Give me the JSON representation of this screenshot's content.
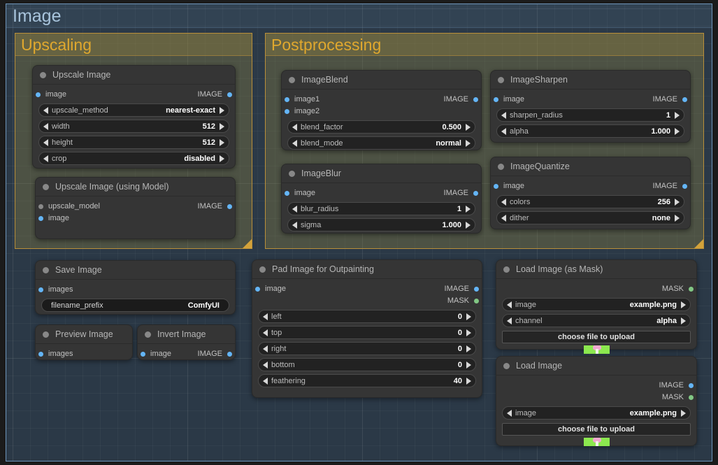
{
  "outer_group": {
    "title": "Image",
    "color": "#6e95bb"
  },
  "groups": [
    {
      "title": "Upscaling",
      "color": "#b98f3a"
    },
    {
      "title": "Postprocessing",
      "color": "#b98f3a"
    }
  ],
  "nodes": {
    "upscale_image": {
      "title": "Upscale Image",
      "inputs": [
        {
          "label": "image",
          "type": "IMAGE"
        }
      ],
      "outputs": [
        {
          "label": "IMAGE",
          "type": "IMAGE"
        }
      ],
      "widgets": [
        {
          "name": "upscale_method",
          "value": "nearest-exact"
        },
        {
          "name": "width",
          "value": "512"
        },
        {
          "name": "height",
          "value": "512"
        },
        {
          "name": "crop",
          "value": "disabled"
        }
      ]
    },
    "upscale_image_model": {
      "title": "Upscale Image (using Model)",
      "inputs": [
        {
          "label": "upscale_model",
          "type": "MODEL"
        },
        {
          "label": "image",
          "type": "IMAGE"
        }
      ],
      "outputs": [
        {
          "label": "IMAGE",
          "type": "IMAGE"
        }
      ],
      "widgets": []
    },
    "save_image": {
      "title": "Save Image",
      "inputs": [
        {
          "label": "images",
          "type": "IMAGE"
        }
      ],
      "outputs": [],
      "widgets": [
        {
          "name": "filename_prefix",
          "value": "ComfyUI",
          "kind": "text"
        }
      ]
    },
    "preview_image": {
      "title": "Preview Image",
      "inputs": [
        {
          "label": "images",
          "type": "IMAGE"
        }
      ],
      "outputs": [],
      "widgets": []
    },
    "invert_image": {
      "title": "Invert Image",
      "inputs": [
        {
          "label": "image",
          "type": "IMAGE"
        }
      ],
      "outputs": [
        {
          "label": "IMAGE",
          "type": "IMAGE"
        }
      ],
      "widgets": []
    },
    "image_blend": {
      "title": "ImageBlend",
      "inputs": [
        {
          "label": "image1",
          "type": "IMAGE"
        },
        {
          "label": "image2",
          "type": "IMAGE"
        }
      ],
      "outputs": [
        {
          "label": "IMAGE",
          "type": "IMAGE"
        }
      ],
      "widgets": [
        {
          "name": "blend_factor",
          "value": "0.500"
        },
        {
          "name": "blend_mode",
          "value": "normal"
        }
      ]
    },
    "image_blur": {
      "title": "ImageBlur",
      "inputs": [
        {
          "label": "image",
          "type": "IMAGE"
        }
      ],
      "outputs": [
        {
          "label": "IMAGE",
          "type": "IMAGE"
        }
      ],
      "widgets": [
        {
          "name": "blur_radius",
          "value": "1"
        },
        {
          "name": "sigma",
          "value": "1.000"
        }
      ]
    },
    "image_sharpen": {
      "title": "ImageSharpen",
      "inputs": [
        {
          "label": "image",
          "type": "IMAGE"
        }
      ],
      "outputs": [
        {
          "label": "IMAGE",
          "type": "IMAGE"
        }
      ],
      "widgets": [
        {
          "name": "sharpen_radius",
          "value": "1"
        },
        {
          "name": "alpha",
          "value": "1.000"
        }
      ]
    },
    "image_quantize": {
      "title": "ImageQuantize",
      "inputs": [
        {
          "label": "image",
          "type": "IMAGE"
        }
      ],
      "outputs": [
        {
          "label": "IMAGE",
          "type": "IMAGE"
        }
      ],
      "widgets": [
        {
          "name": "colors",
          "value": "256"
        },
        {
          "name": "dither",
          "value": "none"
        }
      ]
    },
    "pad_image": {
      "title": "Pad Image for Outpainting",
      "inputs": [
        {
          "label": "image",
          "type": "IMAGE"
        }
      ],
      "outputs": [
        {
          "label": "IMAGE",
          "type": "IMAGE"
        },
        {
          "label": "MASK",
          "type": "MASK"
        }
      ],
      "widgets": [
        {
          "name": "left",
          "value": "0"
        },
        {
          "name": "top",
          "value": "0"
        },
        {
          "name": "right",
          "value": "0"
        },
        {
          "name": "bottom",
          "value": "0"
        },
        {
          "name": "feathering",
          "value": "40"
        }
      ]
    },
    "load_image_mask": {
      "title": "Load Image (as Mask)",
      "inputs": [],
      "outputs": [
        {
          "label": "MASK",
          "type": "MASK"
        }
      ],
      "widgets": [
        {
          "name": "image",
          "value": "example.png"
        },
        {
          "name": "channel",
          "value": "alpha"
        }
      ],
      "button": "choose file to upload"
    },
    "load_image": {
      "title": "Load Image",
      "inputs": [],
      "outputs": [
        {
          "label": "IMAGE",
          "type": "IMAGE"
        },
        {
          "label": "MASK",
          "type": "MASK"
        }
      ],
      "widgets": [
        {
          "name": "image",
          "value": "example.png"
        }
      ],
      "button": "choose file to upload"
    }
  }
}
